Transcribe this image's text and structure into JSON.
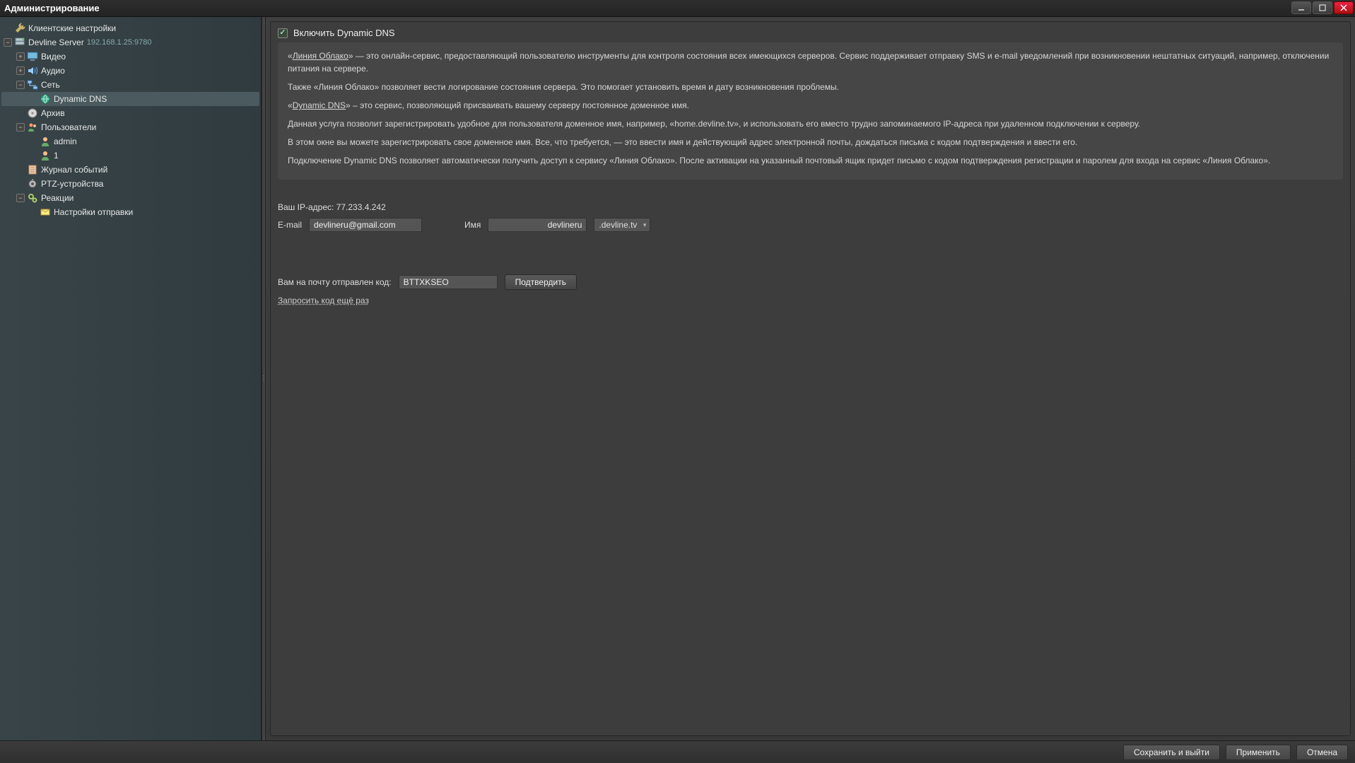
{
  "window": {
    "title": "Администрирование"
  },
  "tree": {
    "client_settings": "Клиентские настройки",
    "server_name": "Devline Server",
    "server_addr": "192.168.1.25:9780",
    "video": "Видео",
    "audio": "Аудио",
    "network": "Сеть",
    "dynamic_dns": "Dynamic DNS",
    "archive": "Архив",
    "users": "Пользователи",
    "user_admin": "admin",
    "user_1": "1",
    "event_log": "Журнал событий",
    "ptz": "PTZ-устройства",
    "reactions": "Реакции",
    "reactions_send": "Настройки отправки"
  },
  "panel": {
    "enable_label": "Включить Dynamic DNS",
    "p1a": "«",
    "link1": "Линия Облако",
    "p1b": "» — это онлайн-сервис, предоставляющий пользователю инструменты для контроля состояния всех имеющихся серверов. Сервис поддерживает отправку SMS и e-mail уведомлений при возникновении нештатных ситуаций, например, отключении питания на сервере.",
    "p2": "Также «Линия Облако» позволяет вести логирование состояния сервера. Это помогает установить время и дату возникновения проблемы.",
    "p3a": "«",
    "link2": "Dynamic DNS",
    "p3b": "» – это сервис, позволяющий присваивать вашему серверу постоянное доменное имя.",
    "p4": "Данная услуга позволит зарегистрировать удобное для пользователя доменное имя, например, «home.devline.tv», и использовать его вместо трудно запоминаемого IP-адреса при удаленном подключении к серверу.",
    "p5": "В этом окне вы можете зарегистрировать свое доменное имя. Все, что требуется, — это ввести имя и действующий адрес электронной почты, дождаться письма с кодом подтверждения и ввести его.",
    "p6": "Подключение Dynamic DNS позволяет автоматически получить доступ к сервису «Линия Облако». После активации на указанный почтовый ящик придет письмо с кодом подтверждения регистрации и паролем для входа на сервис «Линия Облако».",
    "ip_label": "Ваш IP-адрес: ",
    "ip_value": "77.233.4.242",
    "email_label": "E-mail",
    "email_value": "devlineru@gmail.com",
    "name_label": "Имя",
    "name_value": "devlineru",
    "domain_suffix": ".devline.tv",
    "code_sent_label": "Вам на почту отправлен код:",
    "code_value": "BTTXKSEO",
    "confirm_btn": "Подтвердить",
    "resend_link": "Запросить код ещё раз"
  },
  "footer": {
    "save_exit": "Сохранить и выйти",
    "apply": "Применить",
    "cancel": "Отмена"
  }
}
